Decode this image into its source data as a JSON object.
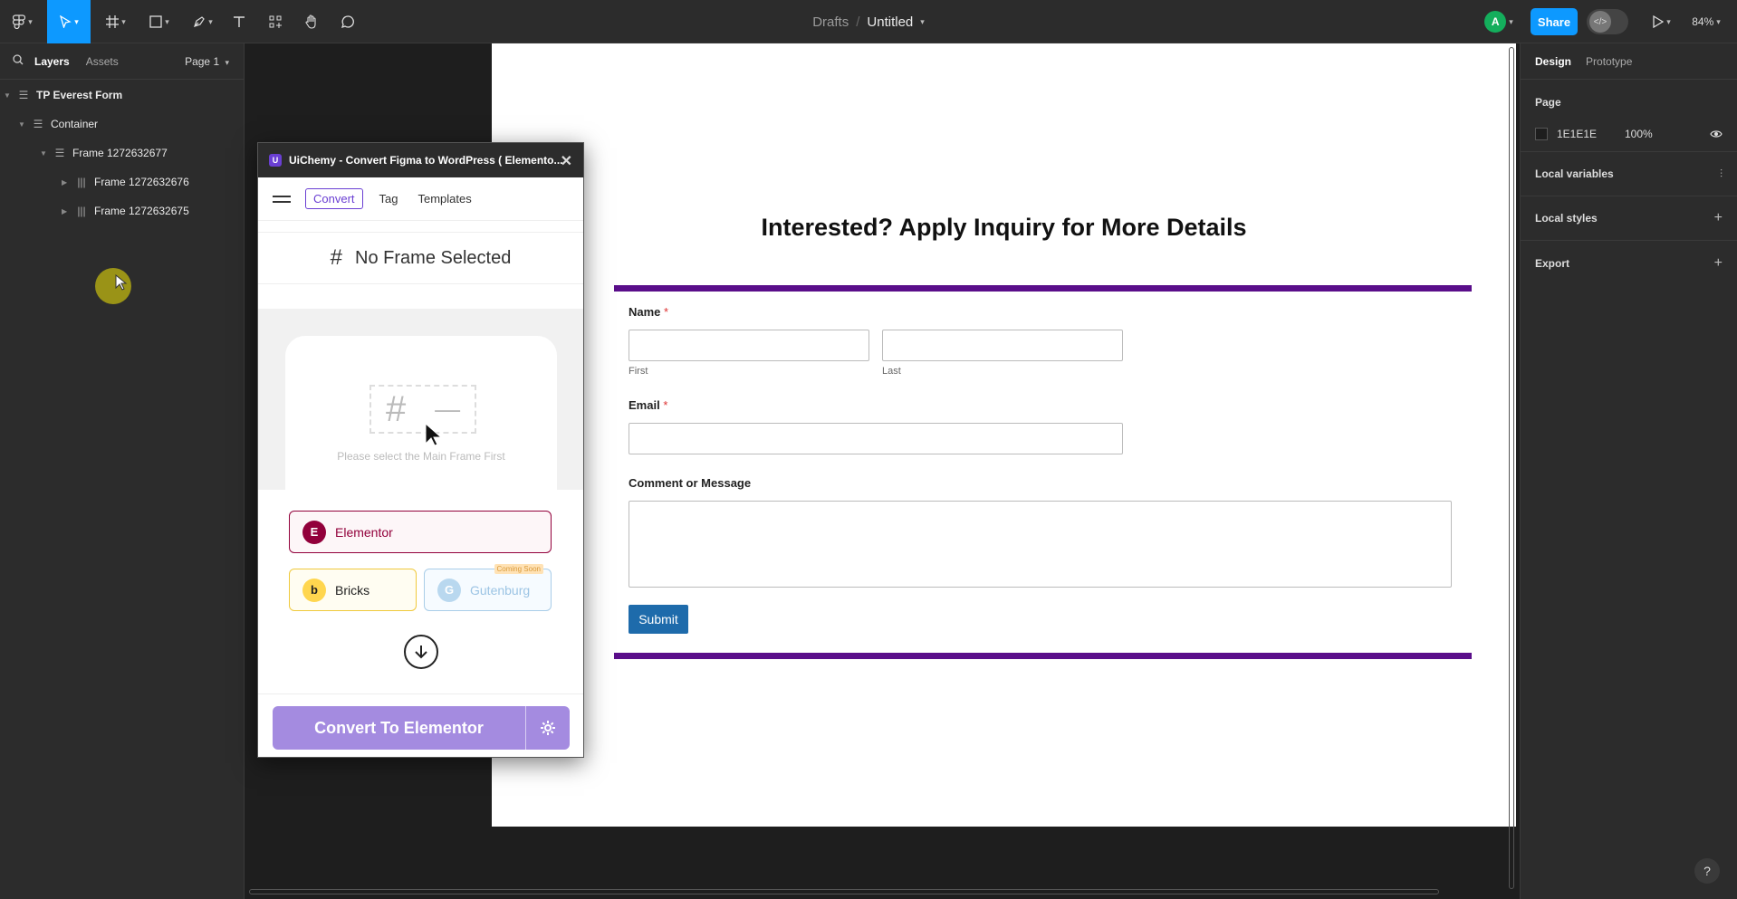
{
  "topbar": {
    "breadcrumb_drafts": "Drafts",
    "breadcrumb_sep": "/",
    "file_title": "Untitled",
    "avatar_letter": "A",
    "share_label": "Share",
    "zoom": "84%"
  },
  "left_panel": {
    "tabs": [
      "Layers",
      "Assets"
    ],
    "page_selector": "Page 1",
    "layers": [
      {
        "label": "TP Everest Form"
      },
      {
        "label": "Container"
      },
      {
        "label": "Frame 1272632677"
      },
      {
        "label": "Frame 1272632676"
      },
      {
        "label": "Frame 1272632675"
      }
    ]
  },
  "right_panel": {
    "tabs": [
      "Design",
      "Prototype"
    ],
    "page_heading": "Page",
    "page_color": "1E1E1E",
    "page_opacity": "100%",
    "sections": [
      "Local variables",
      "Local styles",
      "Export"
    ]
  },
  "plugin": {
    "title": "UiChemy - Convert Figma to WordPress ( Elemento...",
    "logo_letter": "U",
    "nav_tabs": [
      "Convert",
      "Tag",
      "Templates"
    ],
    "no_frame": "No Frame Selected",
    "placeholder_text": "Please select the Main Frame First",
    "builders": {
      "elementor": "Elementor",
      "bricks": "Bricks",
      "gutenburg": "Gutenburg",
      "coming_soon": "Coming Soon"
    },
    "convert_button": "Convert To Elementor"
  },
  "form": {
    "title": "Interested? Apply Inquiry for More Details",
    "name_label": "Name",
    "required_mark": "*",
    "first_label": "First",
    "last_label": "Last",
    "email_label": "Email",
    "comment_label": "Comment or Message",
    "submit_label": "Submit"
  },
  "colors": {
    "accent_blue": "#0d99ff",
    "form_purple": "#5a0e8a",
    "plugin_purple": "#6a3fd3",
    "elementor_red": "#92003b",
    "bricks_yellow": "#ffd64f",
    "submit_blue": "#1e6bab"
  },
  "help": "?"
}
